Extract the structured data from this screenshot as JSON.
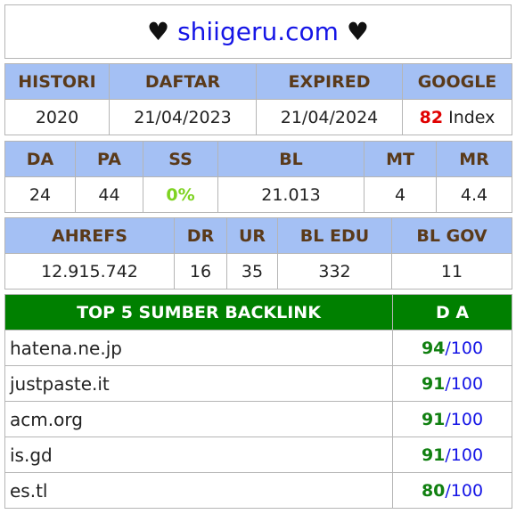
{
  "title": {
    "heart_left": "♥",
    "domain": "shiigeru.com",
    "heart_right": "♥"
  },
  "table1": {
    "headers": [
      "HISTORI",
      "DAFTAR",
      "EXPIRED",
      "GOOGLE"
    ],
    "histori": "2020",
    "daftar": "21/04/2023",
    "expired": "21/04/2024",
    "google_value": "82",
    "google_suffix": "Index"
  },
  "table2": {
    "headers": [
      "DA",
      "PA",
      "SS",
      "BL",
      "MT",
      "MR"
    ],
    "values": [
      "24",
      "44",
      "0%",
      "21.013",
      "4",
      "4.4"
    ]
  },
  "table3": {
    "headers": [
      "AHREFS",
      "DR",
      "UR",
      "BL EDU",
      "BL GOV"
    ],
    "values": [
      "12.915.742",
      "16",
      "35",
      "332",
      "11"
    ]
  },
  "backlinks": {
    "header_source": "TOP 5 SUMBER BACKLINK",
    "header_da": "D A",
    "rows": [
      {
        "site": "hatena.ne.jp",
        "score": "94",
        "max": "/100"
      },
      {
        "site": "justpaste.it",
        "score": "91",
        "max": "/100"
      },
      {
        "site": "acm.org",
        "score": "91",
        "max": "/100"
      },
      {
        "site": "is.gd",
        "score": "91",
        "max": "/100"
      },
      {
        "site": "es.tl",
        "score": "80",
        "max": "/100"
      }
    ]
  },
  "colors": {
    "header_bg": "#a4c0f4",
    "backlink_header_bg": "#008000",
    "domain": "#1515e6",
    "google_value": "#e00000",
    "ss_value": "#7ed321",
    "score": "#118011"
  }
}
